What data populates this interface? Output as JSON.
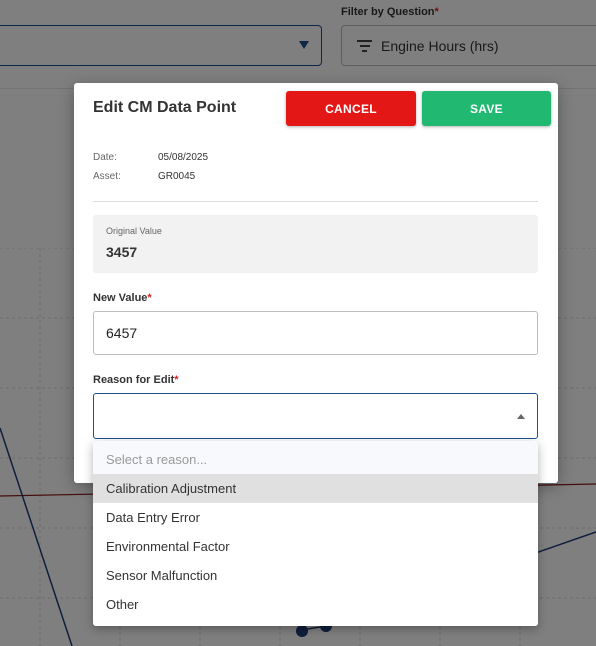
{
  "background": {
    "filter_label": "Filter by Question",
    "filter_required": "*",
    "filter_value": "Engine Hours (hrs)"
  },
  "dialog": {
    "title": "Edit CM Data Point",
    "cancel_label": "CANCEL",
    "save_label": "SAVE",
    "date_label": "Date:",
    "date_value": "05/08/2025",
    "asset_label": "Asset:",
    "asset_value": "GR0045",
    "original_value_label": "Original Value",
    "original_value": "3457",
    "new_value_label": "New Value",
    "new_value_required": "*",
    "new_value": "6457",
    "reason_label": "Reason for Edit",
    "reason_required": "*",
    "reason_value": ""
  },
  "dropdown": {
    "placeholder": "Select a reason...",
    "options": [
      "Calibration Adjustment",
      "Data Entry Error",
      "Environmental Factor",
      "Sensor Malfunction",
      "Other"
    ],
    "highlighted_index": 0
  },
  "colors": {
    "cancel": "#e41717",
    "save": "#21b872",
    "focus_border": "#1e4f8c",
    "required": "#dd2222"
  }
}
